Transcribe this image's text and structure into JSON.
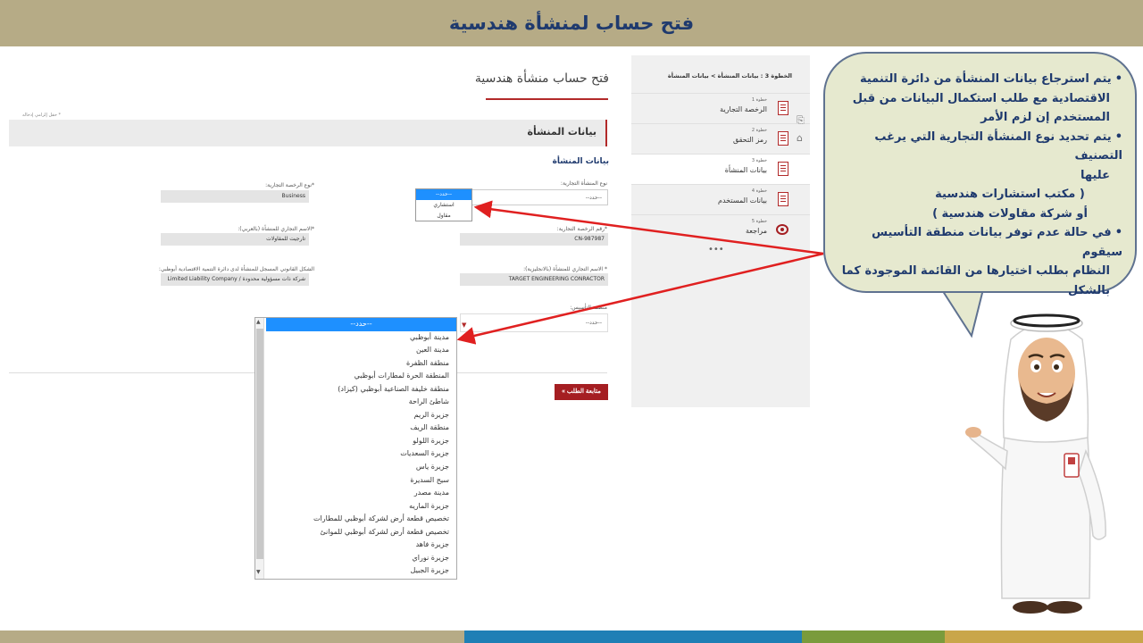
{
  "slide": {
    "title": "فتح حساب لمنشأة هندسية"
  },
  "form": {
    "title": "فتح حساب منشأة هندسية",
    "required_note": "* حقل إلزامي إدخاله",
    "section_title": "بيانات المنشأة",
    "subsection_title": "بيانات المنشأة",
    "fields": {
      "establishment_type_label": "نوع المنشأة التجارية:",
      "establishment_type_value": "--حدد--",
      "license_type_label": "*نوع الرخصة التجارية:",
      "license_type_value": "Business",
      "license_number_label": "*رقم الرخصة التجارية:",
      "license_number_value": "CN-987987",
      "arabic_name_label": "*الاسم التجاري للمنشأة (بالعربي):",
      "arabic_name_value": "تارجيت للمقاولات",
      "english_name_label": "* الاسم التجاري للمنشأة (بالانجليزية):",
      "english_name_value": "TARGET ENGINEERING CONRACTOR",
      "legal_form_label": "الشكل القانوني المسجل للمنشأة لدى دائرة التنمية الاقتصادية أبوظبي:",
      "legal_form_value": "Limited Liability Company / شركة ذات مسؤولية محدودة",
      "region_label": "منطقة التأسيس:",
      "region_value": "--حدد--"
    },
    "type_dropdown": {
      "options": [
        "--حدد--",
        "استشاري",
        "مقاول"
      ],
      "selected": "--حدد--"
    },
    "region_dropdown": {
      "options": [
        "--حدد--",
        "مدينة أبوظبي",
        "مدينة العين",
        "منطقة الظفرة",
        "المنطقة الحرة لمطارات أبوظبي",
        "منطقة خليفة الصناعية أبوظبي (كيزاد)",
        "شاطئ الراحة",
        "جزيرة الريم",
        "منطقة الريف",
        "جزيرة اللولو",
        "جزيرة السعديات",
        "جزيرة ياس",
        "سيح السديرة",
        "مدينة مصدر",
        "جزيرة الماريه",
        "تخصيص قطعة أرض لشركة أبوظبي للمطارات",
        "تخصيص قطعة أرض لشركة أبوظبي للموانئ",
        "جزيرة فاهد",
        "جزيرة نوراي",
        "جزيرة الجبيل"
      ],
      "selected": "--حدد--"
    },
    "submit_label": "متابعة الطلب »"
  },
  "steps": {
    "breadcrumb": "الخطوة 3 : بيانات المنشأة > بيانات المنشأة",
    "items": [
      {
        "num": "خطوة 1",
        "name": "الرخصة التجارية",
        "icon": "document-icon"
      },
      {
        "num": "خطوة 2",
        "name": "رمز التحقق",
        "icon": "document-icon"
      },
      {
        "num": "خطوة 3",
        "name": "بيانات المنشأة",
        "icon": "document-icon"
      },
      {
        "num": "خطوة 4",
        "name": "بيانات المستخدم",
        "icon": "document-icon"
      },
      {
        "num": "خطوة 5",
        "name": "مراجعة",
        "icon": "eye-icon"
      }
    ],
    "more": "•••"
  },
  "bubble": {
    "lines": [
      "يتم استرجاع بيانات المنشأة من دائرة التنمية",
      "الاقتصادية مع طلب استكمال البيانات من قبل",
      "المستخدم إن لزم الأمر",
      "يتم تحديد نوع المنشأة التجارية التي يرغب التصنيف",
      "عليها",
      "( مكتب استشارات هندسية",
      "أو شركة مقاولات هندسية )",
      "في حالة عدم توفر بيانات منطقة التأسيس سيقوم",
      "النظام بطلب اختيارها من القائمة الموجودة كما",
      "بالشكل"
    ]
  },
  "colors": {
    "title_band": "#b6ab86",
    "accent_red": "#b22a2a",
    "arrow_red": "#e02020",
    "bubble_fill": "#e6e9cf",
    "bubble_border": "#5f7290",
    "title_text": "#1f3a6e",
    "footer": [
      "#b6ab86",
      "#1f7fb5",
      "#7a9b3c",
      "#c9a64a"
    ]
  }
}
